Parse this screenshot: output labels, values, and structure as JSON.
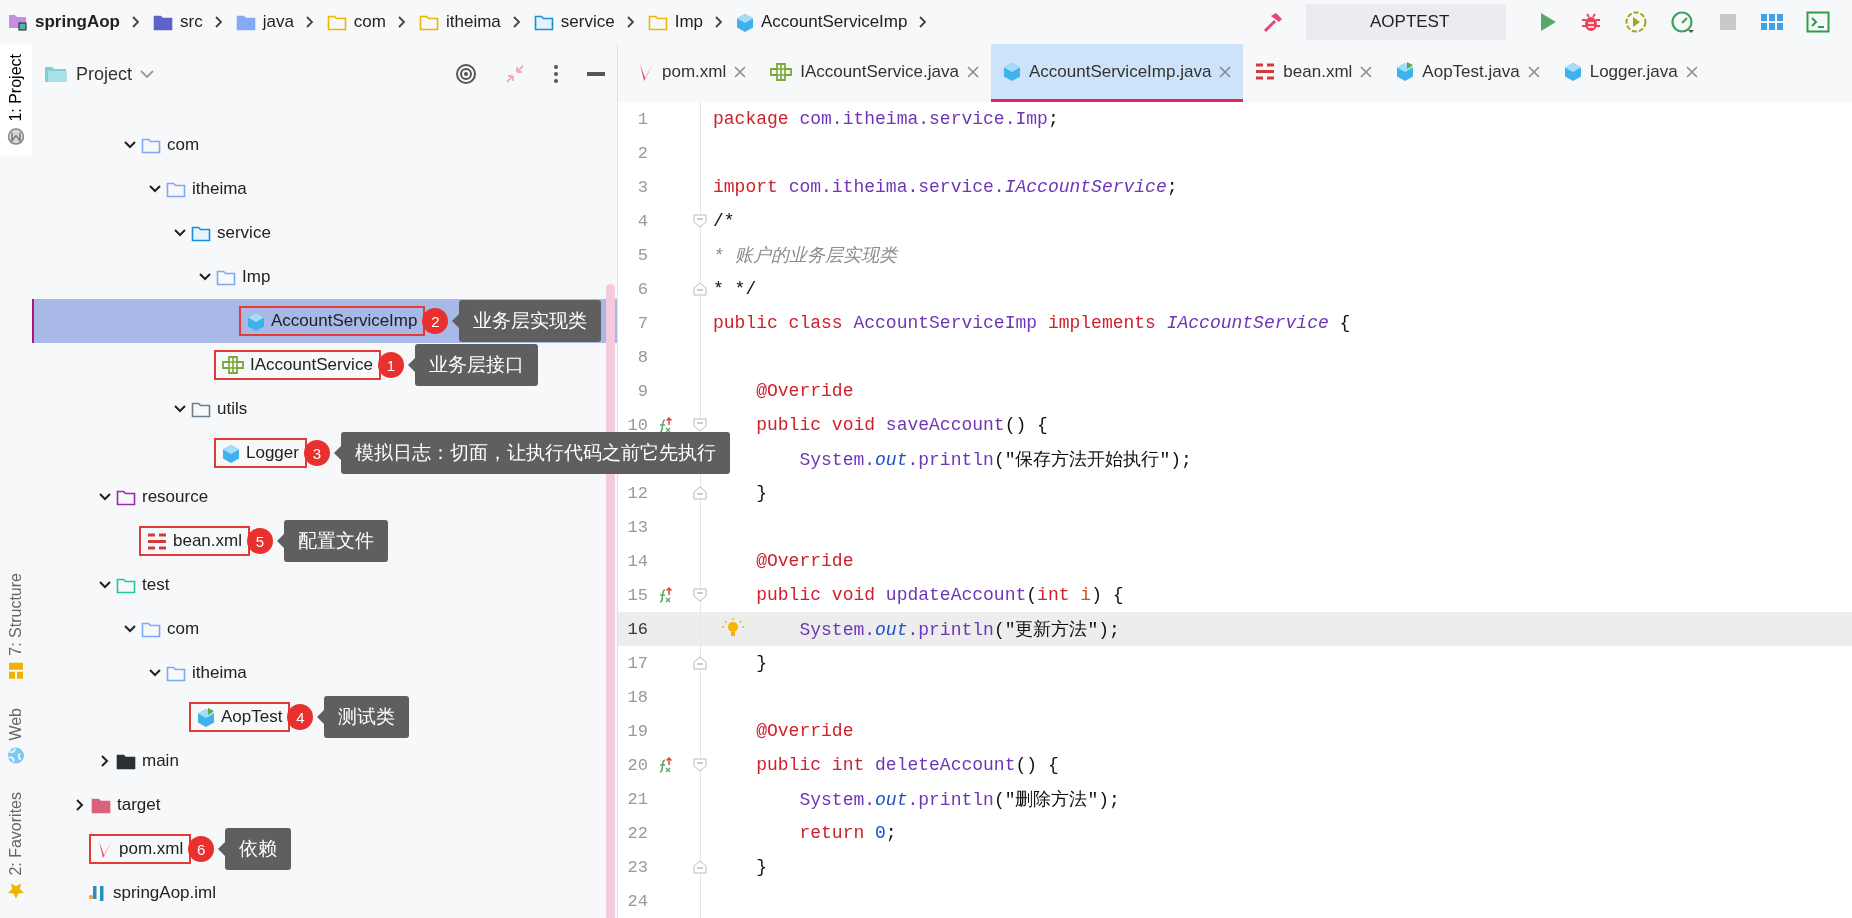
{
  "breadcrumb": [
    {
      "label": "springAop",
      "kind": "module"
    },
    {
      "label": "src",
      "kind": "source"
    },
    {
      "label": "java",
      "kind": "folder-solid"
    },
    {
      "label": "com",
      "kind": "package"
    },
    {
      "label": "itheima",
      "kind": "package"
    },
    {
      "label": "service",
      "kind": "package-source"
    },
    {
      "label": "Imp",
      "kind": "package"
    },
    {
      "label": "AccountServiceImp",
      "kind": "class"
    }
  ],
  "toolbar": [
    {
      "kind": "build",
      "disabled": false
    },
    {
      "kind": "run-config",
      "label": "AOPTEST",
      "disabled": false
    },
    {
      "kind": "run",
      "disabled": false
    },
    {
      "kind": "debug",
      "disabled": false
    },
    {
      "kind": "coverage",
      "disabled": false
    },
    {
      "kind": "profile",
      "disabled": false
    },
    {
      "kind": "stop",
      "disabled": true
    },
    {
      "kind": "layout",
      "disabled": false
    },
    {
      "kind": "terminal",
      "disabled": false
    }
  ],
  "side_tabs": [
    {
      "label": "1: Project",
      "kind": "m-circle",
      "selected": true
    },
    {
      "label": "7: Structure",
      "kind": "structure",
      "selected": false
    },
    {
      "label": "Web",
      "kind": "globe",
      "selected": false
    },
    {
      "label": "2: Favorites",
      "kind": "star",
      "selected": false
    }
  ],
  "project_panel": {
    "title": "Project",
    "tree": [
      {
        "children": [
          {
            "children": [
              {
                "label": "com",
                "kind": "folder",
                "expanded": true,
                "selected": false,
                "children": [
                  {
                    "label": "itheima",
                    "kind": "folder",
                    "expanded": true,
                    "selected": false,
                    "children": [
                      {
                        "label": "service",
                        "kind": "package-source",
                        "expanded": true,
                        "selected": false,
                        "children": [
                          {
                            "label": "Imp",
                            "kind": "folder",
                            "expanded": true,
                            "selected": false,
                            "children": [
                              {
                                "label": "AccountServiceImp",
                                "kind": "class",
                                "selected": true,
                                "callout": {
                                  "number": "2",
                                  "text": "业务层实现类"
                                }
                              }
                            ]
                          },
                          {
                            "label": "IAccountService",
                            "kind": "interface",
                            "selected": false,
                            "callout": {
                              "number": "1",
                              "text": "业务层接口"
                            }
                          }
                        ]
                      },
                      {
                        "label": "utils",
                        "kind": "folder-grey",
                        "expanded": true,
                        "selected": false,
                        "children": [
                          {
                            "label": "Logger",
                            "kind": "class",
                            "selected": false,
                            "callout": {
                              "number": "3",
                              "text": "模拟日志：切面，让执行代码之前它先执行"
                            }
                          }
                        ]
                      }
                    ]
                  }
                ]
              }
            ]
          },
          {
            "label": "resource",
            "kind": "resource-folder",
            "expanded": true,
            "selected": false,
            "children": [
              {
                "label": "bean.xml",
                "kind": "xml",
                "selected": false,
                "callout": {
                  "number": "5",
                  "text": "配置文件"
                }
              }
            ]
          },
          {
            "label": "test",
            "kind": "test-folder",
            "expanded": true,
            "selected": false,
            "children": [
              {
                "label": "com",
                "kind": "folder",
                "expanded": true,
                "selected": false,
                "children": [
                  {
                    "label": "itheima",
                    "kind": "folder",
                    "expanded": true,
                    "selected": false,
                    "children": [
                      {
                        "label": "AopTest",
                        "kind": "test-class",
                        "selected": false,
                        "callout": {
                          "number": "4",
                          "text": "测试类"
                        }
                      }
                    ]
                  }
                ]
              }
            ]
          },
          {
            "label": "main",
            "kind": "folder-dark",
            "expanded": false,
            "selected": false
          }
        ]
      },
      {
        "label": "target",
        "kind": "folder-red",
        "expanded": false,
        "selected": false
      },
      {
        "label": "pom.xml",
        "kind": "maven",
        "selected": false,
        "callout": {
          "number": "6",
          "text": "依赖"
        }
      },
      {
        "label": "springAop.iml",
        "kind": "iml",
        "selected": false
      }
    ]
  },
  "editor_tabs": [
    {
      "label": "pom.xml",
      "kind": "maven",
      "selected": false
    },
    {
      "label": "IAccountService.java",
      "kind": "interface",
      "selected": false
    },
    {
      "label": "AccountServiceImp.java",
      "kind": "class",
      "selected": true
    },
    {
      "label": "bean.xml",
      "kind": "xml",
      "selected": false
    },
    {
      "label": "AopTest.java",
      "kind": "test-class",
      "selected": false
    },
    {
      "label": "Logger.java",
      "kind": "class",
      "selected": false
    }
  ],
  "code": [
    {
      "n": "1",
      "current": false,
      "tokens": [
        {
          "kind": "kw",
          "text": "package "
        },
        {
          "kind": "ident",
          "text": "com.itheima.service.Imp"
        },
        {
          "kind": "plain",
          "text": ";"
        }
      ]
    },
    {
      "n": "2",
      "current": false
    },
    {
      "n": "3",
      "current": false,
      "tokens": [
        {
          "kind": "kw",
          "text": "import "
        },
        {
          "kind": "ident",
          "text": "com.itheima.service."
        },
        {
          "kind": "ident-italic",
          "text": "IAccountService"
        },
        {
          "kind": "plain",
          "text": ";"
        }
      ]
    },
    {
      "n": "4",
      "current": false,
      "markers": [
        {
          "kind": "fold-start"
        }
      ],
      "tokens": [
        {
          "kind": "plain",
          "text": "/*"
        }
      ]
    },
    {
      "n": "5",
      "current": false,
      "tokens": [
        {
          "kind": "comment",
          "text": "* 账户的业务层实现类"
        }
      ]
    },
    {
      "n": "6",
      "current": false,
      "markers": [
        {
          "kind": "fold-end"
        }
      ],
      "tokens": [
        {
          "kind": "plain",
          "text": "* */"
        }
      ]
    },
    {
      "n": "7",
      "current": false,
      "tokens": [
        {
          "kind": "kw",
          "text": "public class "
        },
        {
          "kind": "ident",
          "text": "AccountServiceImp"
        },
        {
          "kind": "kw",
          "text": " implements "
        },
        {
          "kind": "ident-italic",
          "text": "IAccountService"
        },
        {
          "kind": "plain",
          "text": " {"
        }
      ]
    },
    {
      "n": "8",
      "current": false
    },
    {
      "n": "9",
      "current": false,
      "tokens": [
        {
          "kind": "anno",
          "text": "    @Override"
        }
      ]
    },
    {
      "n": "10",
      "current": false,
      "markers": [
        {
          "kind": "override"
        },
        {
          "kind": "fold-start"
        }
      ],
      "tokens": [
        {
          "kind": "kw",
          "text": "    public void "
        },
        {
          "kind": "ident",
          "text": "saveAccount"
        },
        {
          "kind": "plain",
          "text": "() {"
        }
      ]
    },
    {
      "current": false,
      "tokens": [
        {
          "kind": "ident",
          "text": "        System."
        },
        {
          "kind": "field",
          "text": "out"
        },
        {
          "kind": "ident",
          "text": ".println"
        },
        {
          "kind": "plain",
          "text": "("
        },
        {
          "kind": "str",
          "text": "\"保存方法开始执行\""
        },
        {
          "kind": "plain",
          "text": ");"
        }
      ]
    },
    {
      "n": "12",
      "current": false,
      "markers": [
        {
          "kind": "fold-end"
        }
      ],
      "tokens": [
        {
          "kind": "plain",
          "text": "    }"
        }
      ]
    },
    {
      "n": "13",
      "current": false
    },
    {
      "n": "14",
      "current": false,
      "tokens": [
        {
          "kind": "anno",
          "text": "    @Override"
        }
      ]
    },
    {
      "n": "15",
      "current": false,
      "markers": [
        {
          "kind": "override"
        },
        {
          "kind": "fold-start"
        }
      ],
      "tokens": [
        {
          "kind": "kw",
          "text": "    public void "
        },
        {
          "kind": "ident",
          "text": "updateAccount"
        },
        {
          "kind": "plain",
          "text": "("
        },
        {
          "kind": "kw",
          "text": "int "
        },
        {
          "kind": "param",
          "text": "i"
        },
        {
          "kind": "plain",
          "text": ") {"
        }
      ]
    },
    {
      "n": "16",
      "current": true,
      "markers": [
        {
          "kind": "bulb"
        }
      ],
      "tokens": [
        {
          "kind": "ident",
          "text": "        System."
        },
        {
          "kind": "field",
          "text": "out"
        },
        {
          "kind": "ident",
          "text": ".println"
        },
        {
          "kind": "plain",
          "text": "("
        },
        {
          "kind": "str",
          "text": "\"更新方法\""
        },
        {
          "kind": "plain",
          "text": ");"
        }
      ]
    },
    {
      "n": "17",
      "current": false,
      "markers": [
        {
          "kind": "fold-end"
        }
      ],
      "tokens": [
        {
          "kind": "plain",
          "text": "    }"
        }
      ]
    },
    {
      "n": "18",
      "current": false
    },
    {
      "n": "19",
      "current": false,
      "tokens": [
        {
          "kind": "anno",
          "text": "    @Override"
        }
      ]
    },
    {
      "n": "20",
      "current": false,
      "markers": [
        {
          "kind": "override"
        },
        {
          "kind": "fold-start"
        }
      ],
      "tokens": [
        {
          "kind": "kw",
          "text": "    public int "
        },
        {
          "kind": "ident",
          "text": "deleteAccount"
        },
        {
          "kind": "plain",
          "text": "() {"
        }
      ]
    },
    {
      "n": "21",
      "current": false,
      "tokens": [
        {
          "kind": "ident",
          "text": "        System."
        },
        {
          "kind": "field",
          "text": "out"
        },
        {
          "kind": "ident",
          "text": ".println"
        },
        {
          "kind": "plain",
          "text": "("
        },
        {
          "kind": "str",
          "text": "\"删除方法\""
        },
        {
          "kind": "plain",
          "text": ");"
        }
      ]
    },
    {
      "n": "22",
      "current": false,
      "tokens": [
        {
          "kind": "kw",
          "text": "        return "
        },
        {
          "kind": "num",
          "text": "0"
        },
        {
          "kind": "plain",
          "text": ";"
        }
      ]
    },
    {
      "n": "23",
      "current": false,
      "markers": [
        {
          "kind": "fold-end"
        }
      ],
      "tokens": [
        {
          "kind": "plain",
          "text": "    }"
        }
      ]
    },
    {
      "n": "24",
      "current": false
    }
  ]
}
